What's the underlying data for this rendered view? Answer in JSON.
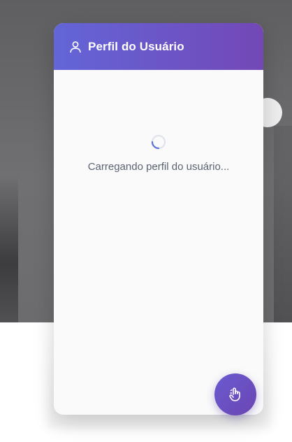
{
  "panel": {
    "title": "Perfil do Usuário",
    "title_icon": "user-icon",
    "header_gradient": [
      "#6365d8",
      "#7348b6"
    ]
  },
  "loading": {
    "text": "Carregando perfil do usuário...",
    "spinner_color": "#5a73d8"
  },
  "fab": {
    "icon": "hand-pointer-icon",
    "color": "#6a52c6"
  }
}
